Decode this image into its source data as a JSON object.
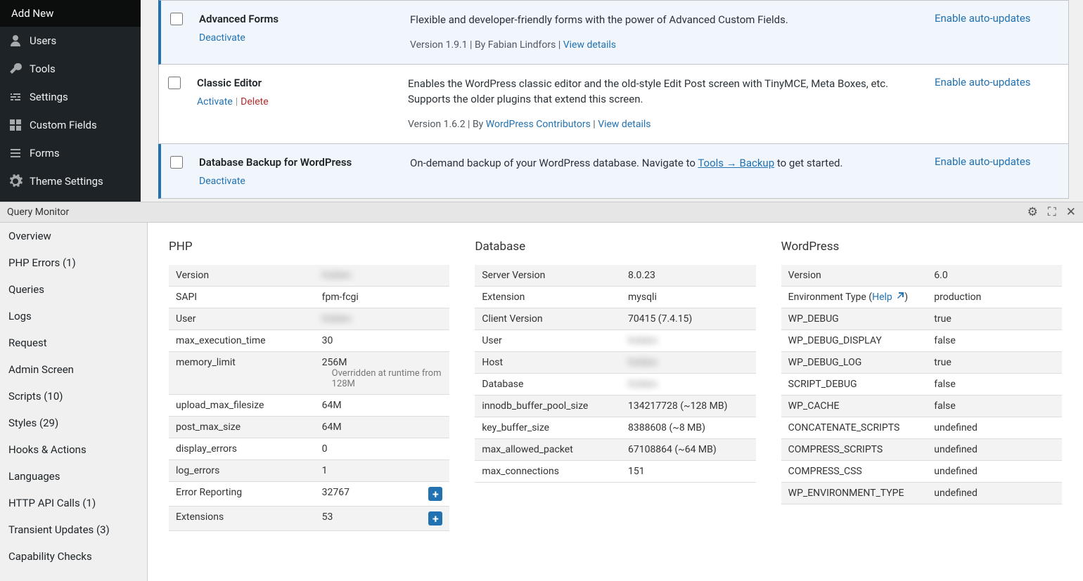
{
  "wp_sidebar": [
    {
      "label": "Add New",
      "icon": ""
    },
    {
      "label": "Users",
      "icon": "users"
    },
    {
      "label": "Tools",
      "icon": "wrench"
    },
    {
      "label": "Settings",
      "icon": "sliders"
    },
    {
      "label": "Custom Fields",
      "icon": "grid"
    },
    {
      "label": "Forms",
      "icon": "list"
    },
    {
      "label": "Theme Settings",
      "icon": "gear"
    }
  ],
  "plugins": [
    {
      "name": "Advanced Forms",
      "active": true,
      "actions": [
        {
          "label": "Deactivate",
          "type": "normal"
        }
      ],
      "description": "Flexible and developer-friendly forms with the power of Advanced Custom Fields.",
      "version_prefix": "Version 1.9.1 | By Fabian Lindfors | ",
      "version_links": [
        {
          "label": "View details",
          "underline": false
        }
      ],
      "auto_update": "Enable auto-updates"
    },
    {
      "name": "Classic Editor",
      "active": false,
      "actions": [
        {
          "label": "Activate",
          "type": "normal"
        },
        {
          "label": "Delete",
          "type": "delete"
        }
      ],
      "description": "Enables the WordPress classic editor and the old-style Edit Post screen with TinyMCE, Meta Boxes, etc. Supports the older plugins that extend this screen.",
      "version_prefix": "Version 1.6.2 | By ",
      "version_links": [
        {
          "label": "WordPress Contributors",
          "underline": false
        },
        {
          "label": "View details",
          "underline": false
        }
      ],
      "auto_update": "Enable auto-updates"
    },
    {
      "name": "Database Backup for WordPress",
      "active": true,
      "actions": [
        {
          "label": "Deactivate",
          "type": "normal"
        }
      ],
      "description_pre": "On-demand backup of your WordPress database. Navigate to ",
      "description_link": "Tools → Backup",
      "description_post": " to get started.",
      "version_prefix": "",
      "version_links": [],
      "auto_update": "Enable auto-updates"
    }
  ],
  "qm": {
    "title": "Query Monitor",
    "sidebar": [
      "Overview",
      "PHP Errors (1)",
      "Queries",
      "Logs",
      "Request",
      "Admin Screen",
      "Scripts (10)",
      "Styles (29)",
      "Hooks & Actions",
      "Languages",
      "HTTP API Calls (1)",
      "Transient Updates (3)",
      "Capability Checks"
    ],
    "cols": [
      {
        "heading": "PHP",
        "rows": [
          {
            "k": "Version",
            "v": "",
            "blur": true
          },
          {
            "k": "SAPI",
            "v": "fpm-fcgi"
          },
          {
            "k": "User",
            "v": "",
            "blur": true
          },
          {
            "k": "max_execution_time",
            "v": "30"
          },
          {
            "k": "memory_limit",
            "v": "256M",
            "sub": "Overridden at runtime from 128M"
          },
          {
            "k": "upload_max_filesize",
            "v": "64M"
          },
          {
            "k": "post_max_size",
            "v": "64M"
          },
          {
            "k": "display_errors",
            "v": "0"
          },
          {
            "k": "log_errors",
            "v": "1"
          },
          {
            "k": "Error Reporting",
            "v": "32767",
            "plus": true
          },
          {
            "k": "Extensions",
            "v": "53",
            "plus": true
          }
        ]
      },
      {
        "heading": "Database",
        "rows": [
          {
            "k": "Server Version",
            "v": "8.0.23"
          },
          {
            "k": "Extension",
            "v": "mysqli"
          },
          {
            "k": "Client Version",
            "v": "70415 (7.4.15)"
          },
          {
            "k": "User",
            "v": "",
            "blur": true
          },
          {
            "k": "Host",
            "v": "",
            "blur": true
          },
          {
            "k": "Database",
            "v": "",
            "blur": true
          },
          {
            "k": "innodb_buffer_pool_size",
            "v": "134217728 (~128 MB)"
          },
          {
            "k": "key_buffer_size",
            "v": "8388608 (~8 MB)"
          },
          {
            "k": "max_allowed_packet",
            "v": "67108864 (~64 MB)"
          },
          {
            "k": "max_connections",
            "v": "151"
          }
        ]
      },
      {
        "heading": "WordPress",
        "rows": [
          {
            "k": "Version",
            "v": "6.0"
          },
          {
            "k": "Environment Type",
            "help": "Help",
            "v": "production"
          },
          {
            "k": "WP_DEBUG",
            "v": "true"
          },
          {
            "k": "WP_DEBUG_DISPLAY",
            "v": "false"
          },
          {
            "k": "WP_DEBUG_LOG",
            "v": "true"
          },
          {
            "k": "SCRIPT_DEBUG",
            "v": "false"
          },
          {
            "k": "WP_CACHE",
            "v": "false"
          },
          {
            "k": "CONCATENATE_SCRIPTS",
            "v": "undefined"
          },
          {
            "k": "COMPRESS_SCRIPTS",
            "v": "undefined"
          },
          {
            "k": "COMPRESS_CSS",
            "v": "undefined"
          },
          {
            "k": "WP_ENVIRONMENT_TYPE",
            "v": "undefined"
          }
        ]
      }
    ]
  }
}
